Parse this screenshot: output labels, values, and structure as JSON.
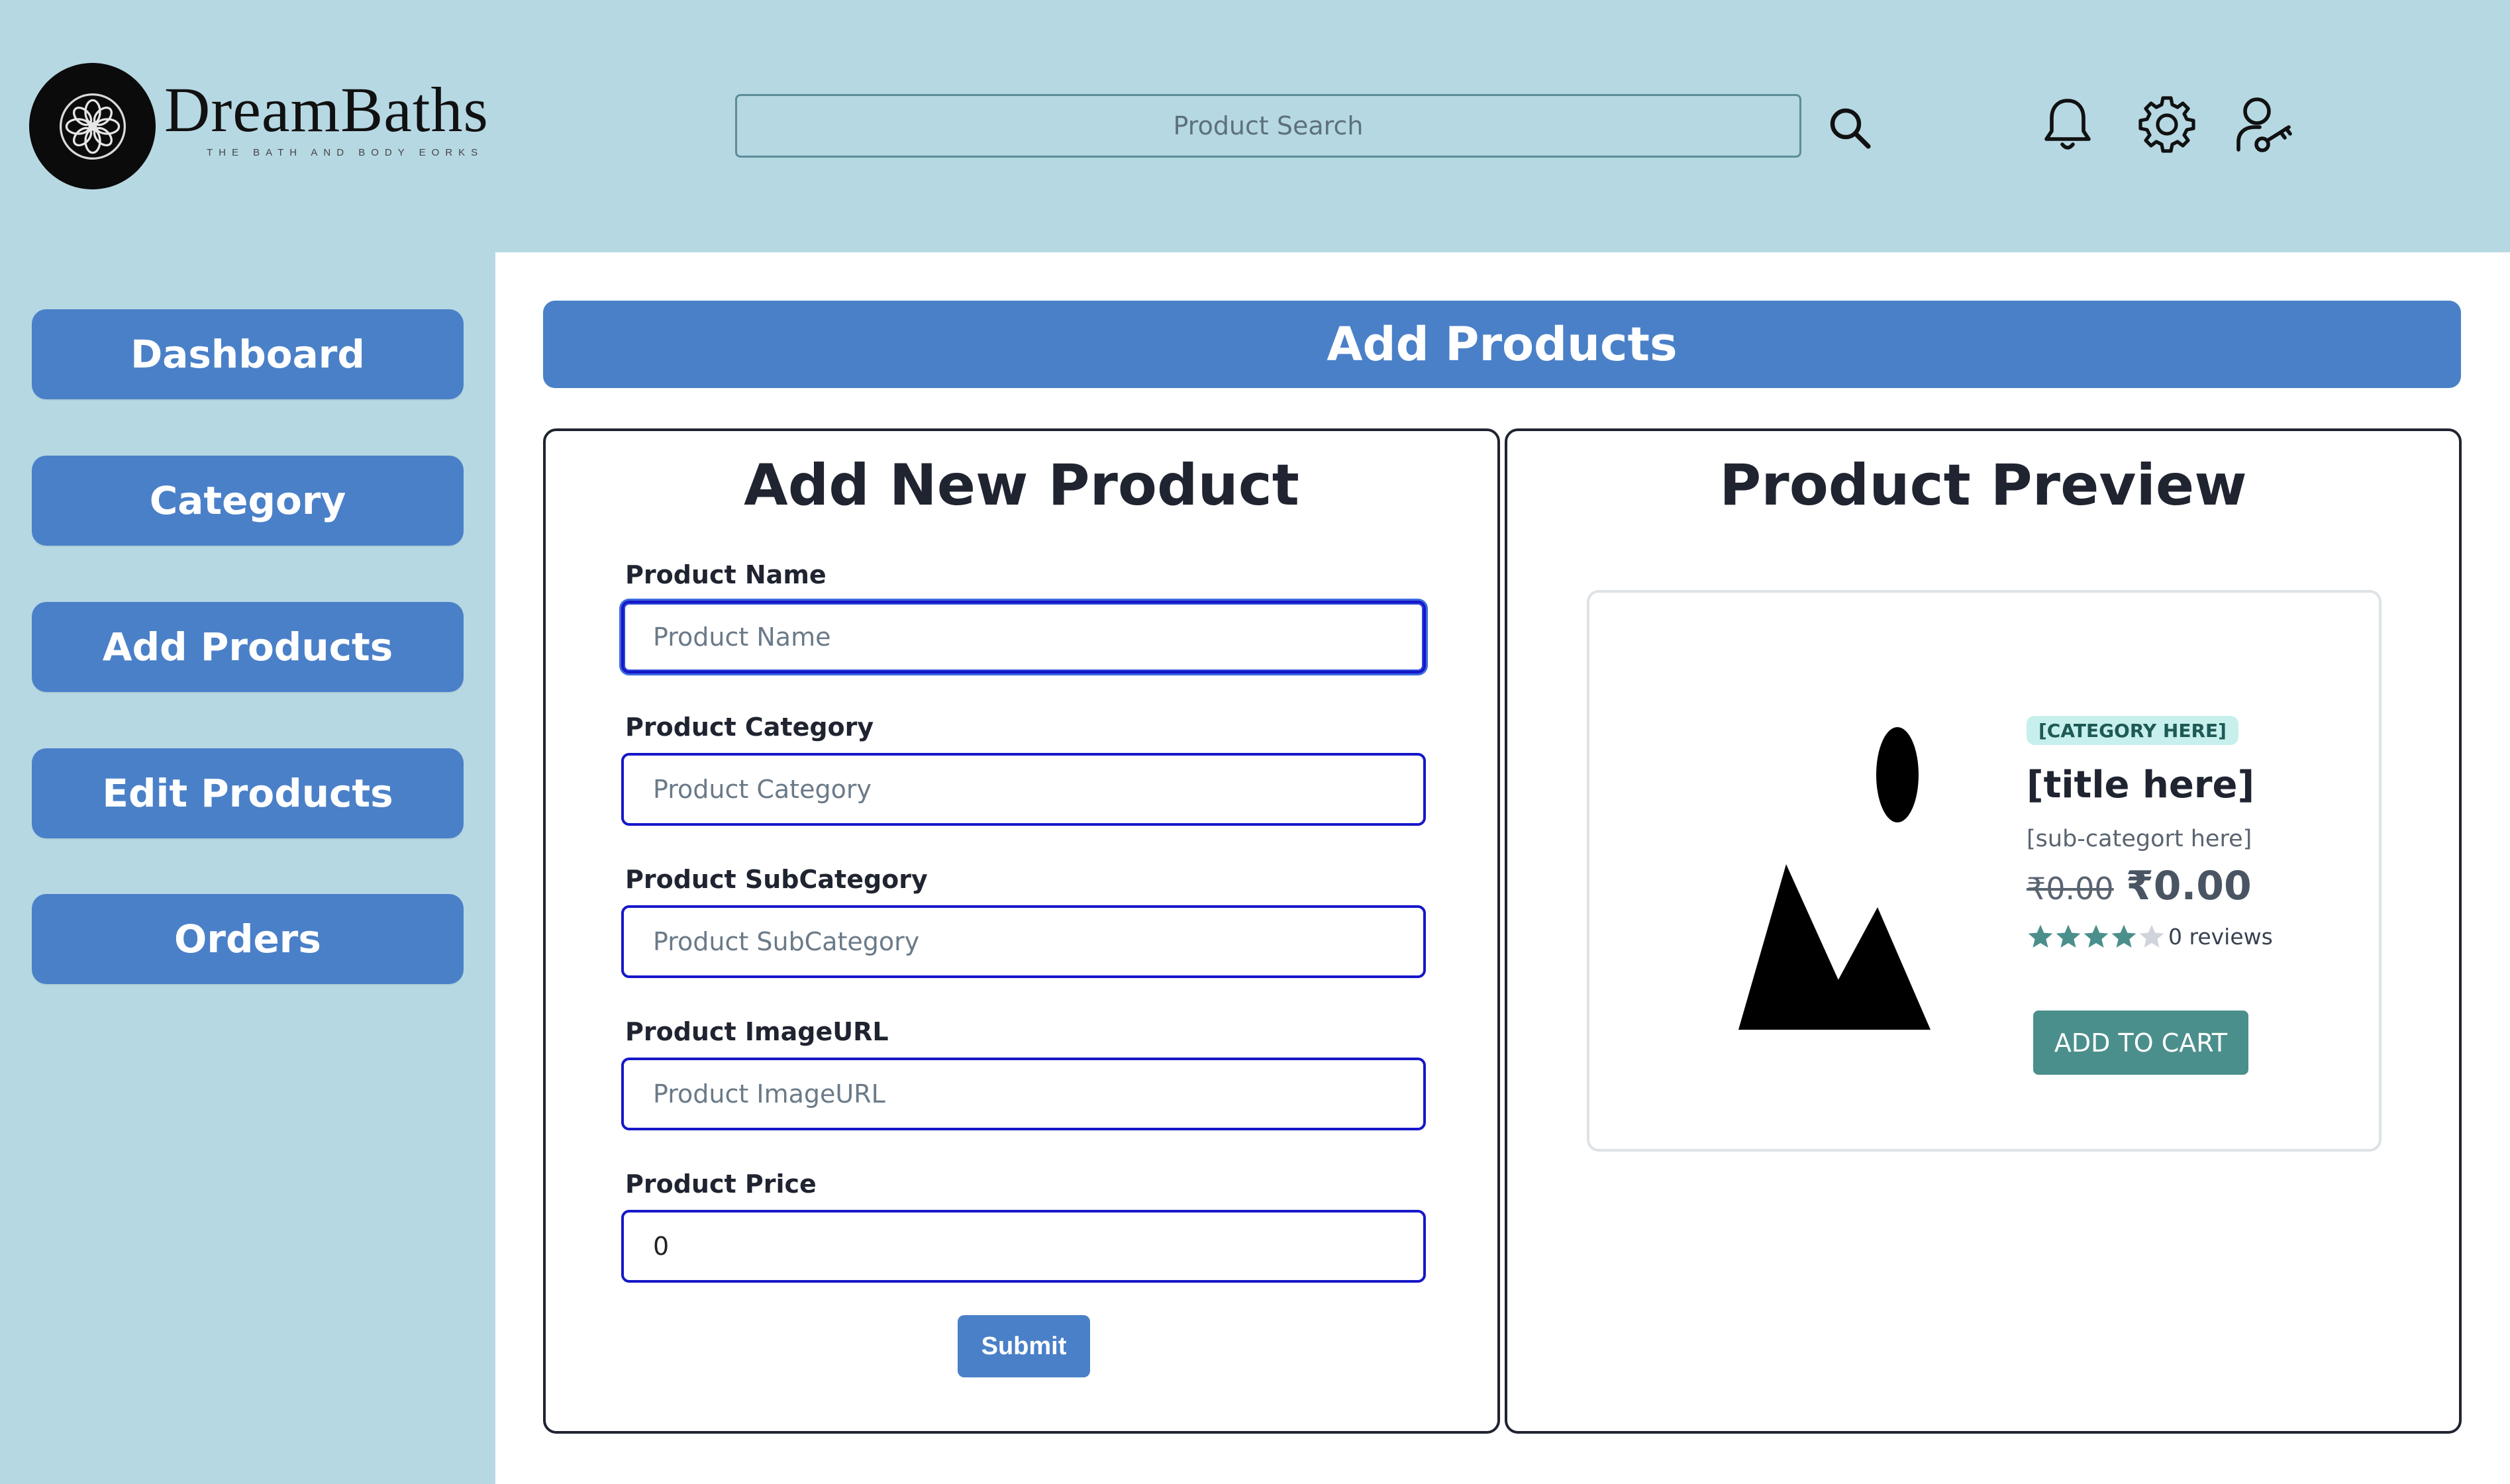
{
  "brand": {
    "name": "DreamBaths",
    "tagline": "THE BATH AND BODY EORKS"
  },
  "header": {
    "search_placeholder": "Product Search",
    "icons": [
      "search-icon",
      "bell-icon",
      "gear-icon",
      "user-key-icon"
    ]
  },
  "sidebar": {
    "items": [
      {
        "label": "Dashboard"
      },
      {
        "label": "Category"
      },
      {
        "label": "Add Products"
      },
      {
        "label": "Edit Products"
      },
      {
        "label": "Orders"
      }
    ]
  },
  "main": {
    "banner": "Add Products",
    "form": {
      "title": "Add New Product",
      "fields": [
        {
          "label": "Product Name",
          "placeholder": "Product Name",
          "value": ""
        },
        {
          "label": "Product Category",
          "placeholder": "Product Category",
          "value": ""
        },
        {
          "label": "Product SubCategory",
          "placeholder": "Product SubCategory",
          "value": ""
        },
        {
          "label": "Product ImageURL",
          "placeholder": "Product ImageURL",
          "value": ""
        },
        {
          "label": "Product Price",
          "placeholder": "",
          "value": "0"
        }
      ],
      "submit_label": "Submit"
    },
    "preview": {
      "title": "Product Preview",
      "card": {
        "category": "[CATEGORY HERE]",
        "title": "[title here]",
        "subcategory": "[sub-categort here]",
        "price_old": "₹0.00",
        "price_new": "₹0.00",
        "rating": 4,
        "rating_max": 5,
        "reviews": "0 reviews",
        "button": "ADD TO CART"
      }
    }
  },
  "colors": {
    "background": "#b6d8e3",
    "accent": "#4a80c8",
    "input_border": "#1717c9",
    "cart_button": "#4b8f8c",
    "badge_bg": "#c7f0ec"
  }
}
